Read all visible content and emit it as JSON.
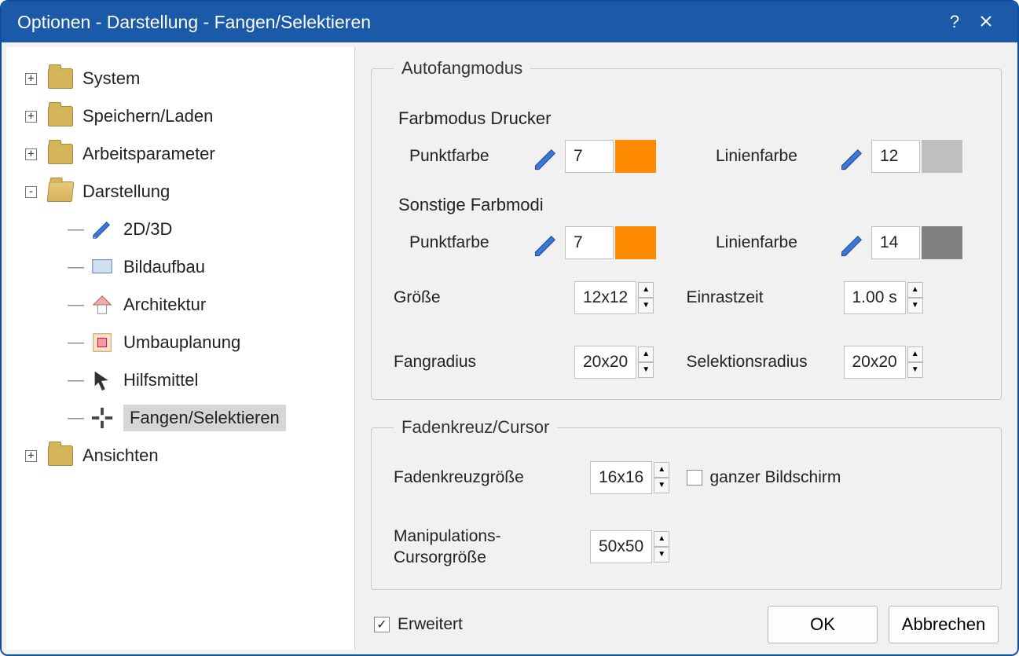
{
  "title": "Optionen - Darstellung - Fangen/Selektieren",
  "tree": {
    "system": "System",
    "save": "Speichern/Laden",
    "params": "Arbeitsparameter",
    "display": "Darstellung",
    "d1": "2D/3D",
    "d2": "Bildaufbau",
    "d3": "Architektur",
    "d4": "Umbauplanung",
    "d5": "Hilfsmittel",
    "d6": "Fangen/Selektieren",
    "views": "Ansichten"
  },
  "group1": {
    "legend": "Autofangmodus",
    "sub1": "Farbmodus Drucker",
    "sub2": "Sonstige Farbmodi",
    "punktfarbe_lbl": "Punktfarbe",
    "linienfarbe_lbl": "Linienfarbe",
    "p1_val": "7",
    "p1_color": "#ff8a00",
    "l1_val": "12",
    "l1_color": "#bfbfbf",
    "p2_val": "7",
    "p2_color": "#ff8a00",
    "l2_val": "14",
    "l2_color": "#808080",
    "size_lbl": "Größe",
    "size_val": "12x12",
    "snap_lbl": "Einrastzeit",
    "snap_val": "1.00 s",
    "rad_lbl": "Fangradius",
    "rad_val": "20x20",
    "selrad_lbl": "Selektionsradius",
    "selrad_val": "20x20"
  },
  "group2": {
    "legend": "Fadenkreuz/Cursor",
    "cross_lbl": "Fadenkreuzgröße",
    "cross_val": "16x16",
    "full_lbl": "ganzer Bildschirm",
    "manip_lbl": "Manipulations-\nCursorgröße",
    "manip_lbl1": "Manipulations-",
    "manip_lbl2": "Cursorgröße",
    "manip_val": "50x50"
  },
  "footer": {
    "extended": "Erweitert",
    "ok": "OK",
    "cancel": "Abbrechen"
  }
}
